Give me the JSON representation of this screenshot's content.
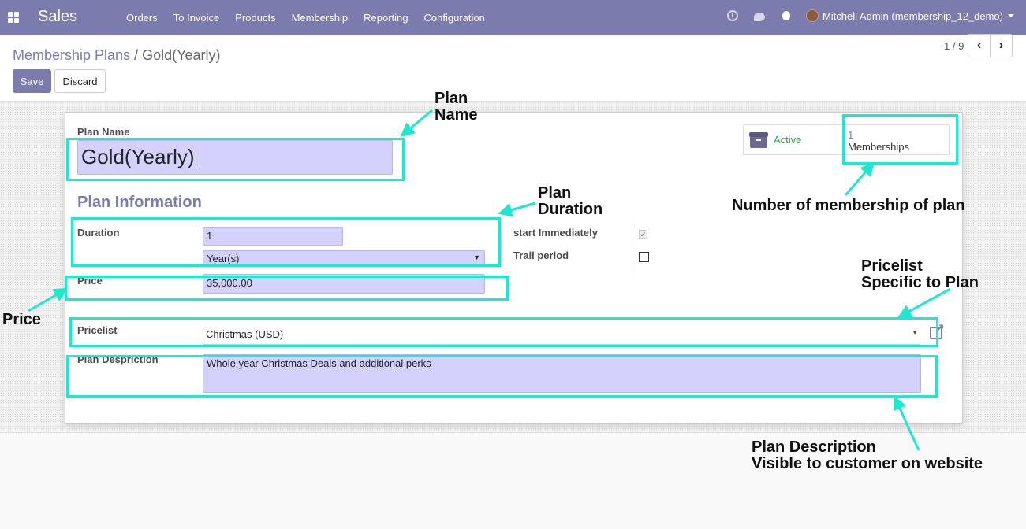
{
  "navbar": {
    "app_title": "Sales",
    "menu": [
      "Orders",
      "To Invoice",
      "Products",
      "Membership",
      "Reporting",
      "Configuration"
    ],
    "user": "Mitchell Admin (membership_12_demo)"
  },
  "breadcrumb": {
    "parent": "Membership Plans",
    "separator": "/",
    "current": "Gold(Yearly)"
  },
  "toolbar": {
    "save_label": "Save",
    "discard_label": "Discard"
  },
  "pager": {
    "value": "1 / 9",
    "prev": "‹",
    "next": "›"
  },
  "form": {
    "plan_name_label": "Plan Name",
    "plan_name_value": "Gold(Yearly)",
    "section_title": "Plan Information",
    "duration_label": "Duration",
    "duration_value": "1",
    "duration_unit": "Year(s)",
    "price_label": "Price",
    "price_value": "35,000.00",
    "start_immediately_label": "start Immediately",
    "start_immediately_checked": true,
    "trail_period_label": "Trail period",
    "trail_period_checked": false,
    "pricelist_label": "Pricelist",
    "pricelist_value": "Christmas (USD)",
    "description_label": "Plan Despriction",
    "description_value": "Whole year Christmas Deals and additional perks"
  },
  "stat_buttons": {
    "active_label": "Active",
    "memberships_count": "1",
    "memberships_label": "Memberships"
  },
  "annotations": {
    "plan_name": [
      "Plan",
      "Name"
    ],
    "plan_duration": [
      "Plan",
      "Duration"
    ],
    "membership_count": "Number of membership of plan",
    "pricelist": [
      "Pricelist",
      "Specific to Plan"
    ],
    "price": "Price",
    "description": [
      "Plan Description",
      "Visible to customer on website"
    ]
  },
  "colors": {
    "brand": "#7c7bad",
    "highlight": "#1de9d0",
    "input_bg": "#d4d2fd",
    "active_green": "#28a745"
  }
}
